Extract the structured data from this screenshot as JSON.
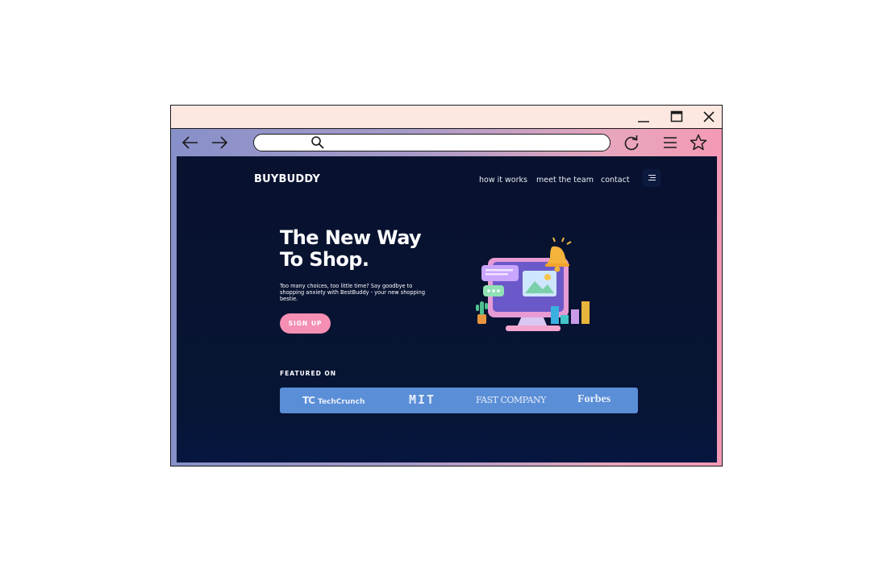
{
  "browser": {
    "window_controls": {
      "minimize": "minimize-icon",
      "maximize": "maximize-icon",
      "close": "close-icon"
    },
    "toolbar_icons": {
      "back": "arrow-left-icon",
      "forward": "arrow-right-icon",
      "reload": "reload-icon",
      "menu": "menu-icon",
      "bookmark": "star-icon"
    },
    "address_bar": {
      "value": "",
      "placeholder": "",
      "icon": "search-icon"
    },
    "frame_gradient": [
      "#8790c9",
      "#f49ab5"
    ],
    "titlebar_color": "#fde8e1"
  },
  "site": {
    "brand": "BUYBUDDY",
    "nav": [
      "how it works",
      "meet the team",
      "contact"
    ],
    "nav_menu_icon": "hamburger-icon",
    "hero": {
      "title": "The New Way To Shop.",
      "subtitle": "Too many choices, too little time? Say goodbye to shopping anxiety with BestBuddy - your new shopping bestie.",
      "cta": "SIGN UP",
      "illustration": "computer-notification-illustration"
    },
    "featured": {
      "title": "FEATURED ON",
      "logos": {
        "techcrunch": {
          "mark": "TC",
          "text": "TechCrunch"
        },
        "mit": "MIT",
        "fast_company": "FAST COMPANY",
        "forbes": "Forbes"
      }
    },
    "colors": {
      "background": "#08122f",
      "accent_pink": "#f58fb4",
      "featured_blue": "#5a8ed6"
    }
  }
}
